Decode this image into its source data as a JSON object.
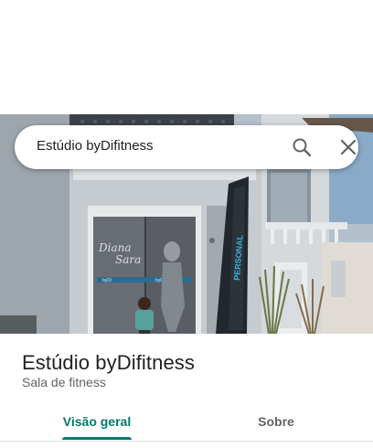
{
  "search": {
    "query": "Estúdio byDifitness"
  },
  "photo": {
    "signage_script": "Diana Sara",
    "totem_text": "PERSONAL",
    "door_brand": "byDi",
    "description_icon": "storefront-photo"
  },
  "place": {
    "title": "Estúdio byDifitness",
    "category": "Sala de fitness"
  },
  "tabs": [
    {
      "label": "Visão geral",
      "active": true
    },
    {
      "label": "Sobre",
      "active": false
    }
  ],
  "colors": {
    "accent": "#00796b",
    "text_primary": "#202124",
    "text_secondary": "#5f6368"
  }
}
